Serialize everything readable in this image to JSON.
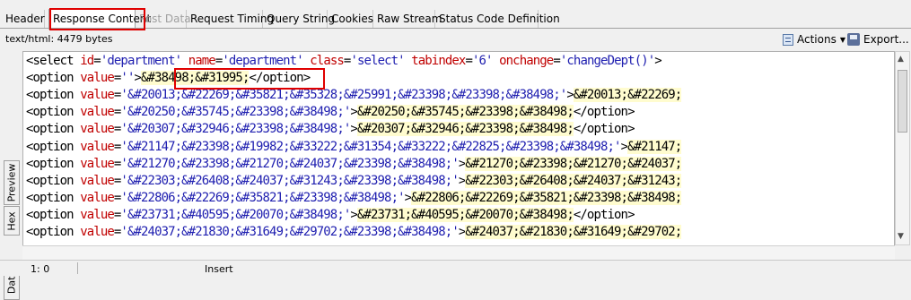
{
  "tabs": [
    {
      "label": "Header",
      "state": "normal"
    },
    {
      "label": "Response Content",
      "state": "active"
    },
    {
      "label": "Post Data",
      "state": "disabled"
    },
    {
      "label": "Request Timing",
      "state": "normal"
    },
    {
      "label": "Query String",
      "state": "normal"
    },
    {
      "label": "Cookies",
      "state": "normal"
    },
    {
      "label": "Raw Stream",
      "state": "normal"
    },
    {
      "label": "Status Code Definition",
      "state": "normal"
    }
  ],
  "info": {
    "content_type": "text/html: 4479 bytes",
    "actions_label": "Actions",
    "export_label": "Export..."
  },
  "side_tabs": [
    "Preview",
    "Hex",
    "Data"
  ],
  "code_lines": [
    [
      [
        "tag",
        "<select "
      ],
      [
        "attr",
        "id"
      ],
      [
        "tag",
        "="
      ],
      [
        "val",
        "'department'"
      ],
      [
        "tag",
        " "
      ],
      [
        "attr",
        "name"
      ],
      [
        "tag",
        "="
      ],
      [
        "val",
        "'department'"
      ],
      [
        "tag",
        " "
      ],
      [
        "attr",
        "class"
      ],
      [
        "tag",
        "="
      ],
      [
        "val",
        "'select'"
      ],
      [
        "tag",
        " "
      ],
      [
        "attr",
        "tabindex"
      ],
      [
        "tag",
        "="
      ],
      [
        "val",
        "'6'"
      ],
      [
        "tag",
        " "
      ],
      [
        "attr",
        "onchange"
      ],
      [
        "tag",
        "="
      ],
      [
        "val",
        "'changeDept()'"
      ],
      [
        "tag",
        ">"
      ]
    ],
    [
      [
        "tag",
        "<option "
      ],
      [
        "attr",
        "value"
      ],
      [
        "tag",
        "="
      ],
      [
        "val",
        "''"
      ],
      [
        "tag",
        ">"
      ],
      [
        "text",
        "&#38498;&#31995;"
      ],
      [
        "tag",
        "</option>"
      ]
    ],
    [
      [
        "tag",
        "<option "
      ],
      [
        "attr",
        "value"
      ],
      [
        "tag",
        "="
      ],
      [
        "val",
        "'&#20013;&#22269;&#35821;&#35328;&#25991;&#23398;&#23398;&#38498;'"
      ],
      [
        "tag",
        ">"
      ],
      [
        "text",
        "&#20013;&#22269;"
      ]
    ],
    [
      [
        "tag",
        "<option "
      ],
      [
        "attr",
        "value"
      ],
      [
        "tag",
        "="
      ],
      [
        "val",
        "'&#20250;&#35745;&#23398;&#38498;'"
      ],
      [
        "tag",
        ">"
      ],
      [
        "text",
        "&#20250;&#35745;&#23398;&#38498;"
      ],
      [
        "tag",
        "</option>"
      ]
    ],
    [
      [
        "tag",
        "<option "
      ],
      [
        "attr",
        "value"
      ],
      [
        "tag",
        "="
      ],
      [
        "val",
        "'&#20307;&#32946;&#23398;&#38498;'"
      ],
      [
        "tag",
        ">"
      ],
      [
        "text",
        "&#20307;&#32946;&#23398;&#38498;"
      ],
      [
        "tag",
        "</option>"
      ]
    ],
    [
      [
        "tag",
        "<option "
      ],
      [
        "attr",
        "value"
      ],
      [
        "tag",
        "="
      ],
      [
        "val",
        "'&#21147;&#23398;&#19982;&#33222;&#31354;&#33222;&#22825;&#23398;&#38498;'"
      ],
      [
        "tag",
        ">"
      ],
      [
        "text",
        "&#21147;"
      ]
    ],
    [
      [
        "tag",
        "<option "
      ],
      [
        "attr",
        "value"
      ],
      [
        "tag",
        "="
      ],
      [
        "val",
        "'&#21270;&#23398;&#21270;&#24037;&#23398;&#38498;'"
      ],
      [
        "tag",
        ">"
      ],
      [
        "text",
        "&#21270;&#23398;&#21270;&#24037;"
      ]
    ],
    [
      [
        "tag",
        "<option "
      ],
      [
        "attr",
        "value"
      ],
      [
        "tag",
        "="
      ],
      [
        "val",
        "'&#22303;&#26408;&#24037;&#31243;&#23398;&#38498;'"
      ],
      [
        "tag",
        ">"
      ],
      [
        "text",
        "&#22303;&#26408;&#24037;&#31243;"
      ]
    ],
    [
      [
        "tag",
        "<option "
      ],
      [
        "attr",
        "value"
      ],
      [
        "tag",
        "="
      ],
      [
        "val",
        "'&#22806;&#22269;&#35821;&#23398;&#38498;'"
      ],
      [
        "tag",
        ">"
      ],
      [
        "text",
        "&#22806;&#22269;&#35821;&#23398;&#38498;"
      ]
    ],
    [
      [
        "tag",
        "<option "
      ],
      [
        "attr",
        "value"
      ],
      [
        "tag",
        "="
      ],
      [
        "val",
        "'&#23731;&#40595;&#20070;&#38498;'"
      ],
      [
        "tag",
        ">"
      ],
      [
        "text",
        "&#23731;&#40595;&#20070;&#38498;"
      ],
      [
        "tag",
        "</option>"
      ]
    ],
    [
      [
        "tag",
        "<option "
      ],
      [
        "attr",
        "value"
      ],
      [
        "tag",
        "="
      ],
      [
        "val",
        "'&#24037;&#21830;&#31649;&#29702;&#23398;&#38498;'"
      ],
      [
        "tag",
        ">"
      ],
      [
        "text",
        "&#24037;&#21830;&#31649;&#29702;"
      ]
    ]
  ],
  "status": {
    "position": "1: 0",
    "mode": "Insert"
  }
}
